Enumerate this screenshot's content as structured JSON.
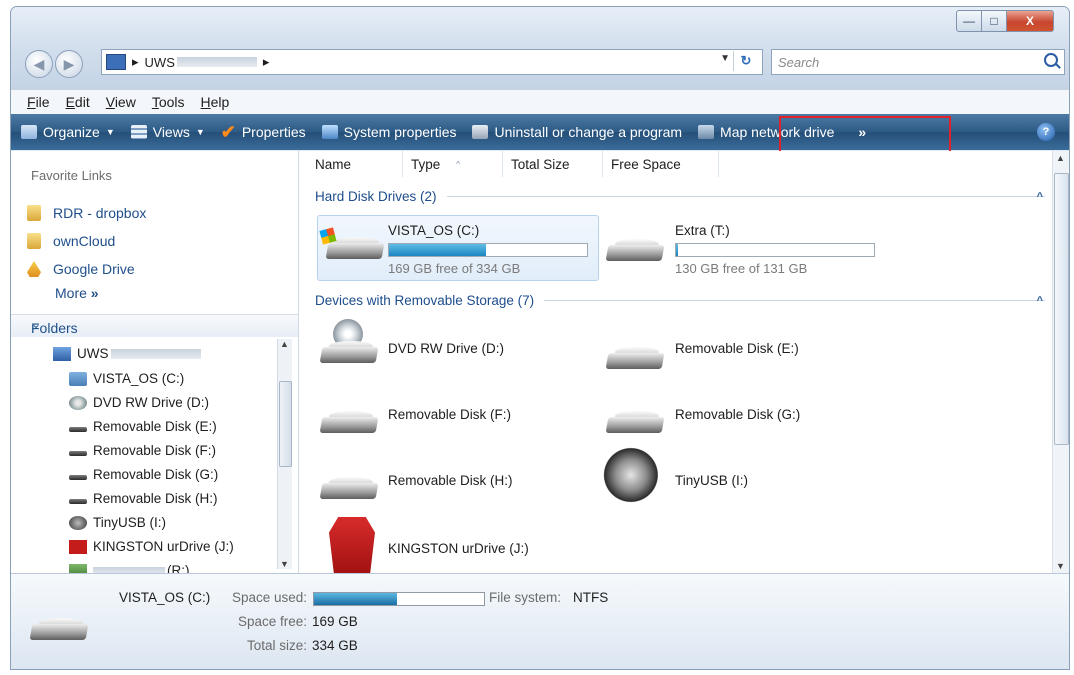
{
  "window": {
    "controls": [
      "—",
      "□",
      "X"
    ]
  },
  "navigation": {
    "back_icon": "back-arrow-icon",
    "forward_icon": "forward-arrow-icon",
    "address_prefix": "UWS",
    "address_separator_1": "▸",
    "address_separator_2": "▸",
    "search_placeholder": "Search"
  },
  "menu": [
    "File",
    "Edit",
    "View",
    "Tools",
    "Help"
  ],
  "toolbar": {
    "organize": "Organize",
    "views": "Views",
    "properties": "Properties",
    "system_properties": "System properties",
    "uninstall": "Uninstall or change a program",
    "map_network_drive": "Map network drive",
    "overflow": "»",
    "help": "?"
  },
  "sidebar": {
    "favorites_title": "Favorite Links",
    "favorites": [
      "RDR - dropbox",
      "ownCloud",
      "Google Drive"
    ],
    "more": "More",
    "more_glyph": "»",
    "folders_title": "Folders",
    "tree": [
      {
        "label": "UWS",
        "icon": "computer-icon"
      },
      {
        "label": "VISTA_OS (C:)",
        "icon": "hard-drive-icon"
      },
      {
        "label": "DVD RW Drive (D:)",
        "icon": "dvd-drive-icon"
      },
      {
        "label": "Removable Disk (E:)",
        "icon": "removable-disk-icon"
      },
      {
        "label": "Removable Disk (F:)",
        "icon": "removable-disk-icon"
      },
      {
        "label": "Removable Disk (G:)",
        "icon": "removable-disk-icon"
      },
      {
        "label": "Removable Disk (H:)",
        "icon": "removable-disk-icon"
      },
      {
        "label": "TinyUSB (I:)",
        "icon": "usb-drive-icon"
      },
      {
        "label": "KINGSTON urDrive (J:)",
        "icon": "kingston-drive-icon"
      },
      {
        "label": "(R:)",
        "icon": "network-drive-icon"
      }
    ]
  },
  "columns": [
    "Name",
    "Type",
    "Total Size",
    "Free Space"
  ],
  "groups": {
    "hard_disk": "Hard Disk Drives (2)",
    "removable": "Devices with Removable Storage (7)"
  },
  "hard_drives": [
    {
      "name": "VISTA_OS (C:)",
      "free_text": "169 GB free of 334 GB",
      "used_fraction": 0.49
    },
    {
      "name": "Extra (T:)",
      "free_text": "130 GB free of 131 GB",
      "used_fraction": 0.01
    }
  ],
  "removable_drives": [
    "DVD RW Drive (D:)",
    "Removable Disk (E:)",
    "Removable Disk (F:)",
    "Removable Disk (G:)",
    "Removable Disk (H:)",
    "TinyUSB (I:)",
    "KINGSTON urDrive (J:)"
  ],
  "details": {
    "drive_name": "VISTA_OS (C:)",
    "space_used_label": "Space used:",
    "space_used_fraction": 0.49,
    "space_free_label": "Space free:",
    "space_free_value": "169 GB",
    "total_size_label": "Total size:",
    "total_size_value": "334 GB",
    "fs_label": "File system:",
    "fs_value": "NTFS"
  }
}
